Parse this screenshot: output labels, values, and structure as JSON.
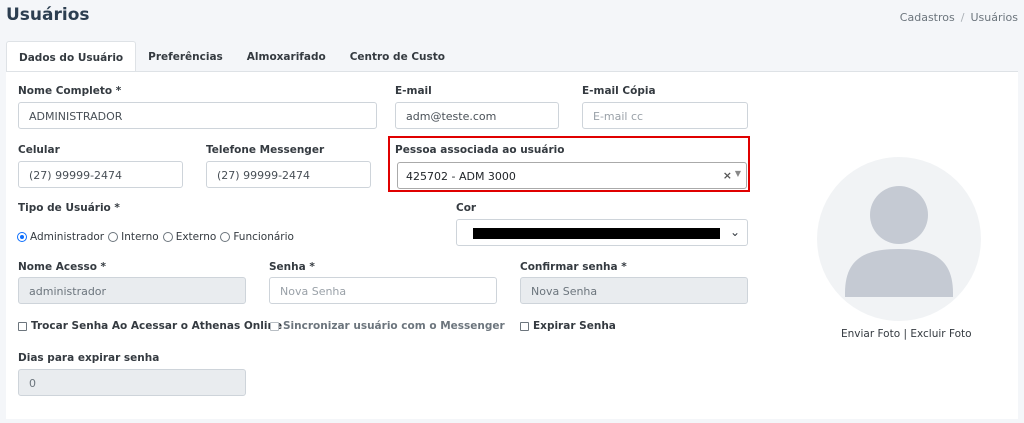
{
  "page": {
    "title": "Usuários"
  },
  "breadcrumb": {
    "items": [
      "Cadastros",
      "Usuários"
    ],
    "separator": "/"
  },
  "tabs": [
    "Dados do Usuário",
    "Preferências",
    "Almoxarifado",
    "Centro de Custo"
  ],
  "form": {
    "nome_completo": {
      "label": "Nome Completo *",
      "value": "ADMINISTRADOR"
    },
    "email": {
      "label": "E-mail",
      "value": "adm@teste.com"
    },
    "email_copia": {
      "label": "E-mail Cópia",
      "placeholder": "E-mail cc"
    },
    "celular": {
      "label": "Celular",
      "value": "(27) 99999-2474"
    },
    "telefone_messenger": {
      "label": "Telefone Messenger",
      "value": "(27) 99999-2474"
    },
    "pessoa_associada": {
      "label": "Pessoa associada ao usuário",
      "value": "425702 - ADM 3000",
      "clear": "×",
      "arrow": "▼"
    },
    "tipo_usuario": {
      "label": "Tipo de Usuário *",
      "options": [
        "Administrador",
        "Interno",
        "Externo",
        "Funcionário"
      ],
      "selected": "Administrador"
    },
    "cor": {
      "label": "Cor",
      "value_color": "#000000",
      "chevron": "⌄"
    },
    "nome_acesso": {
      "label": "Nome Acesso *",
      "value": "administrador"
    },
    "senha": {
      "label": "Senha *",
      "placeholder": "Nova Senha"
    },
    "confirmar_senha": {
      "label": "Confirmar senha *",
      "placeholder": "Nova Senha"
    },
    "trocar_senha": {
      "label": "Trocar Senha Ao Acessar o Athenas Online"
    },
    "sincronizar": {
      "label": "Sincronizar usuário com o Messenger"
    },
    "expirar_senha": {
      "label": "Expirar Senha"
    },
    "dias_expirar": {
      "label": "Dias para expirar senha",
      "value": "0"
    }
  },
  "photo": {
    "enviar": "Enviar Foto",
    "separator": "|",
    "excluir": "Excluir Foto"
  },
  "colors": {
    "highlight": "#e00000",
    "radio_accent": "#0d6efd",
    "title": "#2c3e50"
  }
}
